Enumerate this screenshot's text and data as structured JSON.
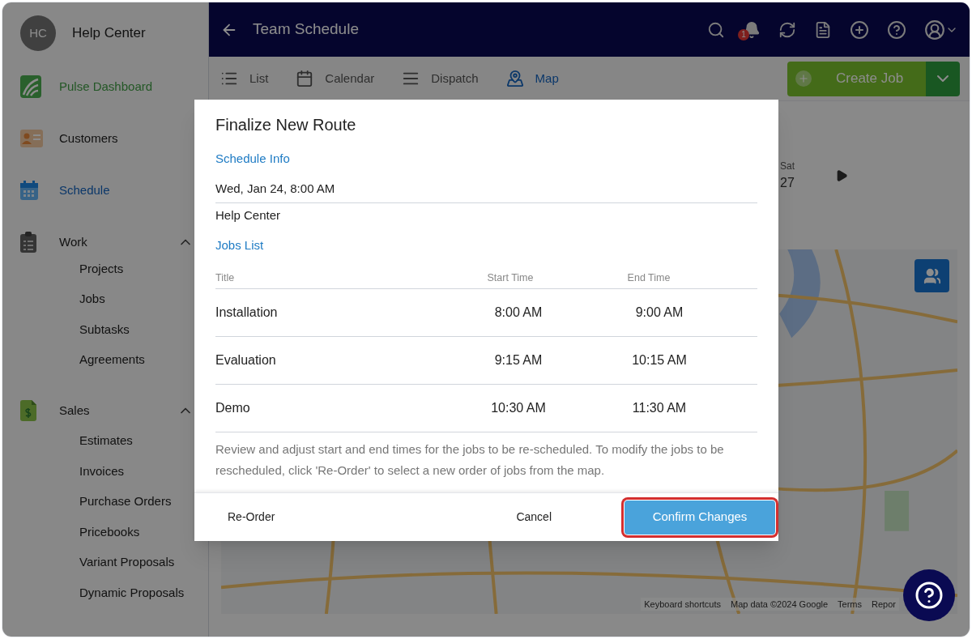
{
  "sidebar": {
    "avatar": "HC",
    "name": "Help Center",
    "items": [
      {
        "kind": "featured",
        "label": "Pulse Dashboard",
        "selected": false
      },
      {
        "kind": "link",
        "label": "Customers",
        "selected": false
      },
      {
        "kind": "link",
        "label": "Schedule",
        "selected": true
      },
      {
        "kind": "group",
        "label": "Work",
        "selected": false,
        "expanded": true,
        "children": [
          {
            "label": "Projects"
          },
          {
            "label": "Jobs"
          },
          {
            "label": "Subtasks"
          },
          {
            "label": "Agreements"
          }
        ]
      },
      {
        "kind": "group",
        "label": "Sales",
        "selected": false,
        "expanded": true,
        "children": [
          {
            "label": "Estimates"
          },
          {
            "label": "Invoices"
          },
          {
            "label": "Purchase Orders"
          },
          {
            "label": "Pricebooks"
          },
          {
            "label": "Variant Proposals"
          },
          {
            "label": "Dynamic Proposals"
          }
        ]
      }
    ]
  },
  "topbar": {
    "title": "Team Schedule",
    "notifications": "1"
  },
  "view_tabs": [
    {
      "label": "List",
      "selected": false
    },
    {
      "label": "Calendar",
      "selected": false
    },
    {
      "label": "Dispatch",
      "selected": false
    },
    {
      "label": "Map",
      "selected": true
    }
  ],
  "create_button": "Create Job",
  "calendar": {
    "day_name": "Sat",
    "day_number": "27"
  },
  "map": {
    "attribution": [
      "Keyboard shortcuts",
      "Map data ©2024 Google",
      "Terms",
      "Repor"
    ]
  },
  "dialog": {
    "title": "Finalize New Route",
    "schedule_heading": "Schedule Info",
    "date": "Wed, Jan 24, 8:00 AM",
    "team": "Help Center",
    "jobs_heading": "Jobs List",
    "columns": [
      "Title",
      "Start Time",
      "End Time"
    ],
    "rows": [
      {
        "title": "Installation",
        "start": "8:00 AM",
        "end": "9:00 AM"
      },
      {
        "title": "Evaluation",
        "start": "9:15 AM",
        "end": "10:15 AM"
      },
      {
        "title": "Demo",
        "start": "10:30 AM",
        "end": "11:30 AM"
      }
    ],
    "note": "Review and adjust start and end times for the jobs to be re-scheduled. To modify the jobs to be rescheduled, click 'Re-Order' to select a new order of jobs from the map.",
    "buttons": {
      "reorder": "Re-Order",
      "cancel": "Cancel",
      "confirm": "Confirm Changes"
    }
  }
}
